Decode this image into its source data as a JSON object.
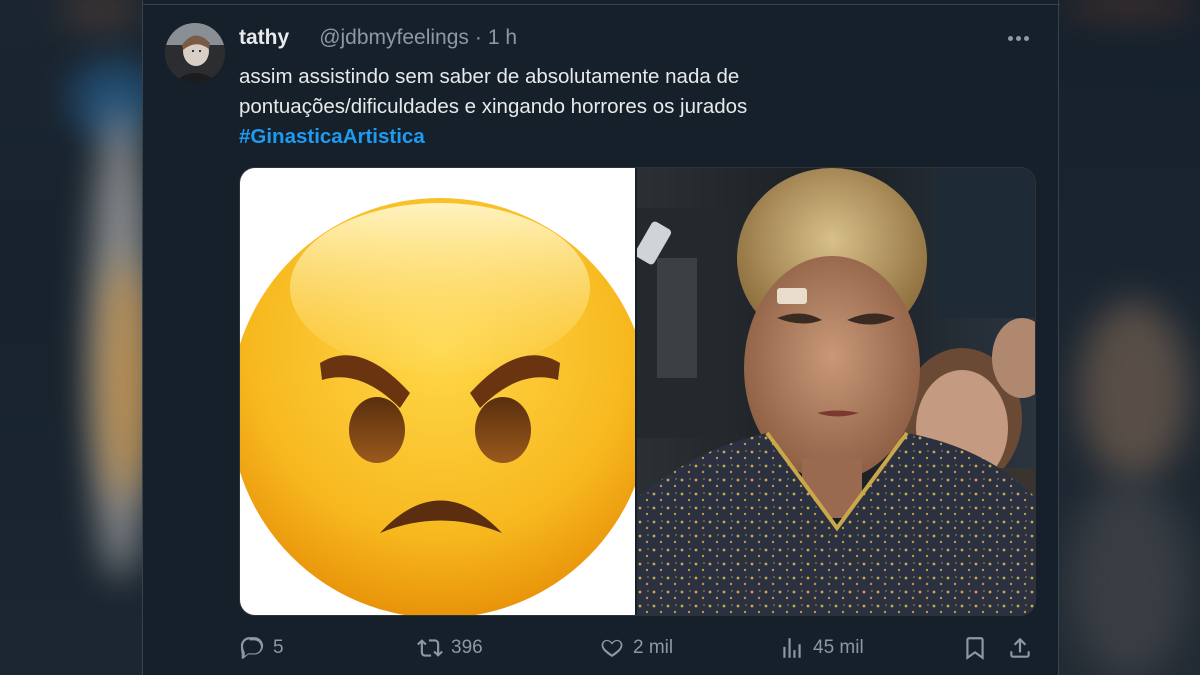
{
  "tweet": {
    "author_name": "tathy",
    "handle": "@jdbmyfeelings",
    "separator": "·",
    "time": "1 h",
    "text_line1": "assim assistindo sem saber de absolutamente nada de",
    "text_line2": "pontuações/dificuldades e xingando horrores os jurados",
    "hashtag": "#GinasticaArtistica"
  },
  "media": {
    "left_image": "angry-face-emoji",
    "right_image": "gymnast-photo"
  },
  "actions": {
    "replies": "5",
    "retweets": "396",
    "likes": "2 mil",
    "views": "45 mil"
  },
  "colors": {
    "background": "#15202b",
    "text": "#e7e9ea",
    "muted": "#8b98a5",
    "link": "#1d9bf0",
    "border": "#38444d"
  },
  "icons": [
    "more-icon",
    "reply-icon",
    "retweet-icon",
    "like-icon",
    "views-icon",
    "bookmark-icon",
    "share-icon"
  ]
}
